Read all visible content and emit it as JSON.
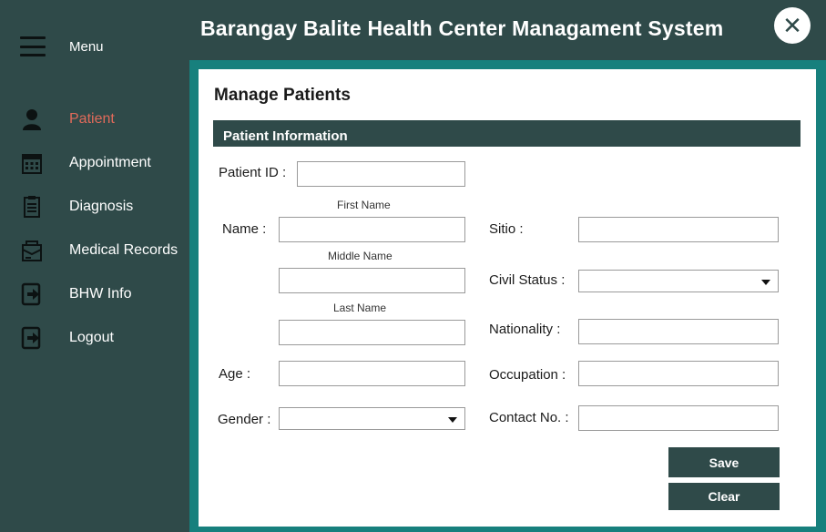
{
  "app_title": "Barangay Balite Health Center Managament System",
  "sidebar": {
    "menu_label": "Menu",
    "items": [
      {
        "label": "Patient",
        "icon": "person-icon",
        "active": true
      },
      {
        "label": "Appointment",
        "icon": "calendar-icon",
        "active": false
      },
      {
        "label": "Diagnosis",
        "icon": "clipboard-icon",
        "active": false
      },
      {
        "label": "Medical Records",
        "icon": "records-folder-icon",
        "active": false
      },
      {
        "label": "BHW Info",
        "icon": "arrow-door-icon",
        "active": false
      },
      {
        "label": "Logout",
        "icon": "logout-icon",
        "active": false
      }
    ]
  },
  "page_title": "Manage Patients",
  "section_title": "Patient Information",
  "form": {
    "patient_id_label": "Patient ID :",
    "name_label": "Name :",
    "first_name_label": "First Name",
    "middle_name_label": "Middle Name",
    "last_name_label": "Last Name",
    "age_label": "Age :",
    "gender_label": "Gender :",
    "sitio_label": "Sitio :",
    "civil_status_label": "Civil Status :",
    "nationality_label": "Nationality :",
    "occupation_label": "Occupation :",
    "contact_label": "Contact No. :",
    "patient_id_value": "",
    "first_name_value": "",
    "middle_name_value": "",
    "last_name_value": "",
    "age_value": "",
    "gender_value": "",
    "sitio_value": "",
    "civil_status_value": "",
    "nationality_value": "",
    "occupation_value": "",
    "contact_value": ""
  },
  "buttons": {
    "save": "Save",
    "clear": "Clear"
  },
  "colors": {
    "sidebar_bg": "#2f4a49",
    "accent_teal": "#17807d",
    "active_item": "#e06a5a"
  }
}
